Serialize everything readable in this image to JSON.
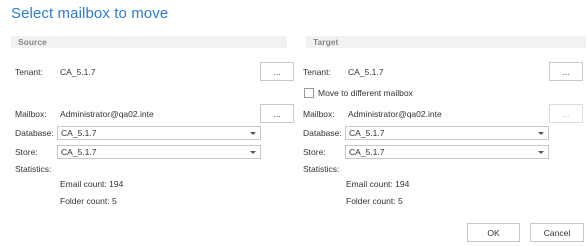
{
  "dialog": {
    "title": "Select mailbox to move"
  },
  "source": {
    "header": "Source",
    "tenant_label": "Tenant:",
    "tenant_value": "CA_5.1.7",
    "tenant_browse": "...",
    "mailbox_label": "Mailbox:",
    "mailbox_value": "Administrator@qa02.inte",
    "mailbox_browse": "...",
    "database_label": "Database:",
    "database_value": "CA_5.1.7",
    "store_label": "Store:",
    "store_value": "CA_5.1.7",
    "statistics_label": "Statistics:",
    "email_count": "Email count: 194",
    "folder_count": "Folder count: 5"
  },
  "target": {
    "header": "Target",
    "tenant_label": "Tenant:",
    "tenant_value": "CA_5.1.7",
    "tenant_browse": "...",
    "move_checkbox_label": "Move to different mailbox",
    "move_checkbox_checked": false,
    "mailbox_label": "Mailbox:",
    "mailbox_value": "Administrator@qa02.inte",
    "mailbox_browse": "...",
    "database_label": "Database:",
    "database_value": "CA_5.1.7",
    "store_label": "Store:",
    "store_value": "CA_5.1.7",
    "statistics_label": "Statistics:",
    "email_count": "Email count: 194",
    "folder_count": "Folder count: 5"
  },
  "footer": {
    "ok_label": "OK",
    "cancel_label": "Cancel"
  }
}
